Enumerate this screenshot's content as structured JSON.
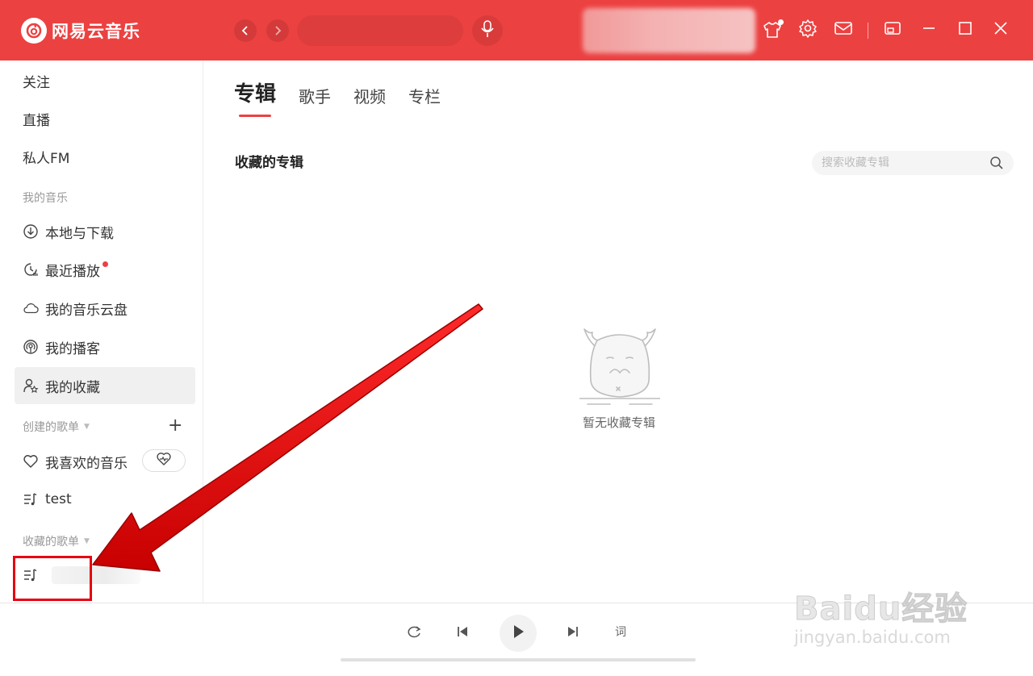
{
  "app": {
    "name": "网易云音乐",
    "brand_color": "#ec4141"
  },
  "titlebar": {
    "icons": [
      "back-icon",
      "forward-icon",
      "mic-icon",
      "skin-icon",
      "settings-icon",
      "mail-icon",
      "mini-mode-icon",
      "minimize-icon",
      "maximize-icon",
      "close-icon"
    ]
  },
  "sidebar": {
    "top_items": [
      {
        "label": "关注"
      },
      {
        "label": "直播"
      },
      {
        "label": "私人FM"
      }
    ],
    "my_music_heading": "我的音乐",
    "my_music_items": [
      {
        "label": "本地与下载",
        "icon": "download-icon"
      },
      {
        "label": "最近播放",
        "icon": "recent-icon",
        "badge": true
      },
      {
        "label": "我的音乐云盘",
        "icon": "cloud-icon"
      },
      {
        "label": "我的播客",
        "icon": "podcast-icon"
      },
      {
        "label": "我的收藏",
        "icon": "collection-icon",
        "active": true
      }
    ],
    "created_heading": "创建的歌单",
    "created_items": [
      {
        "label": "我喜欢的音乐",
        "icon": "heart-icon"
      },
      {
        "label": "test",
        "icon": "playlist-icon"
      }
    ],
    "collected_heading": "收藏的歌单"
  },
  "main": {
    "tabs": [
      {
        "label": "专辑",
        "active": true
      },
      {
        "label": "歌手"
      },
      {
        "label": "视频"
      },
      {
        "label": "专栏"
      }
    ],
    "section_title": "收藏的专辑",
    "search_placeholder": "搜索收藏专辑",
    "empty_text": "暂无收藏专辑"
  },
  "player": {
    "lyric_label": "词"
  },
  "watermark": {
    "main": "Baidu经验",
    "sub": "jingyan.baidu.com"
  }
}
